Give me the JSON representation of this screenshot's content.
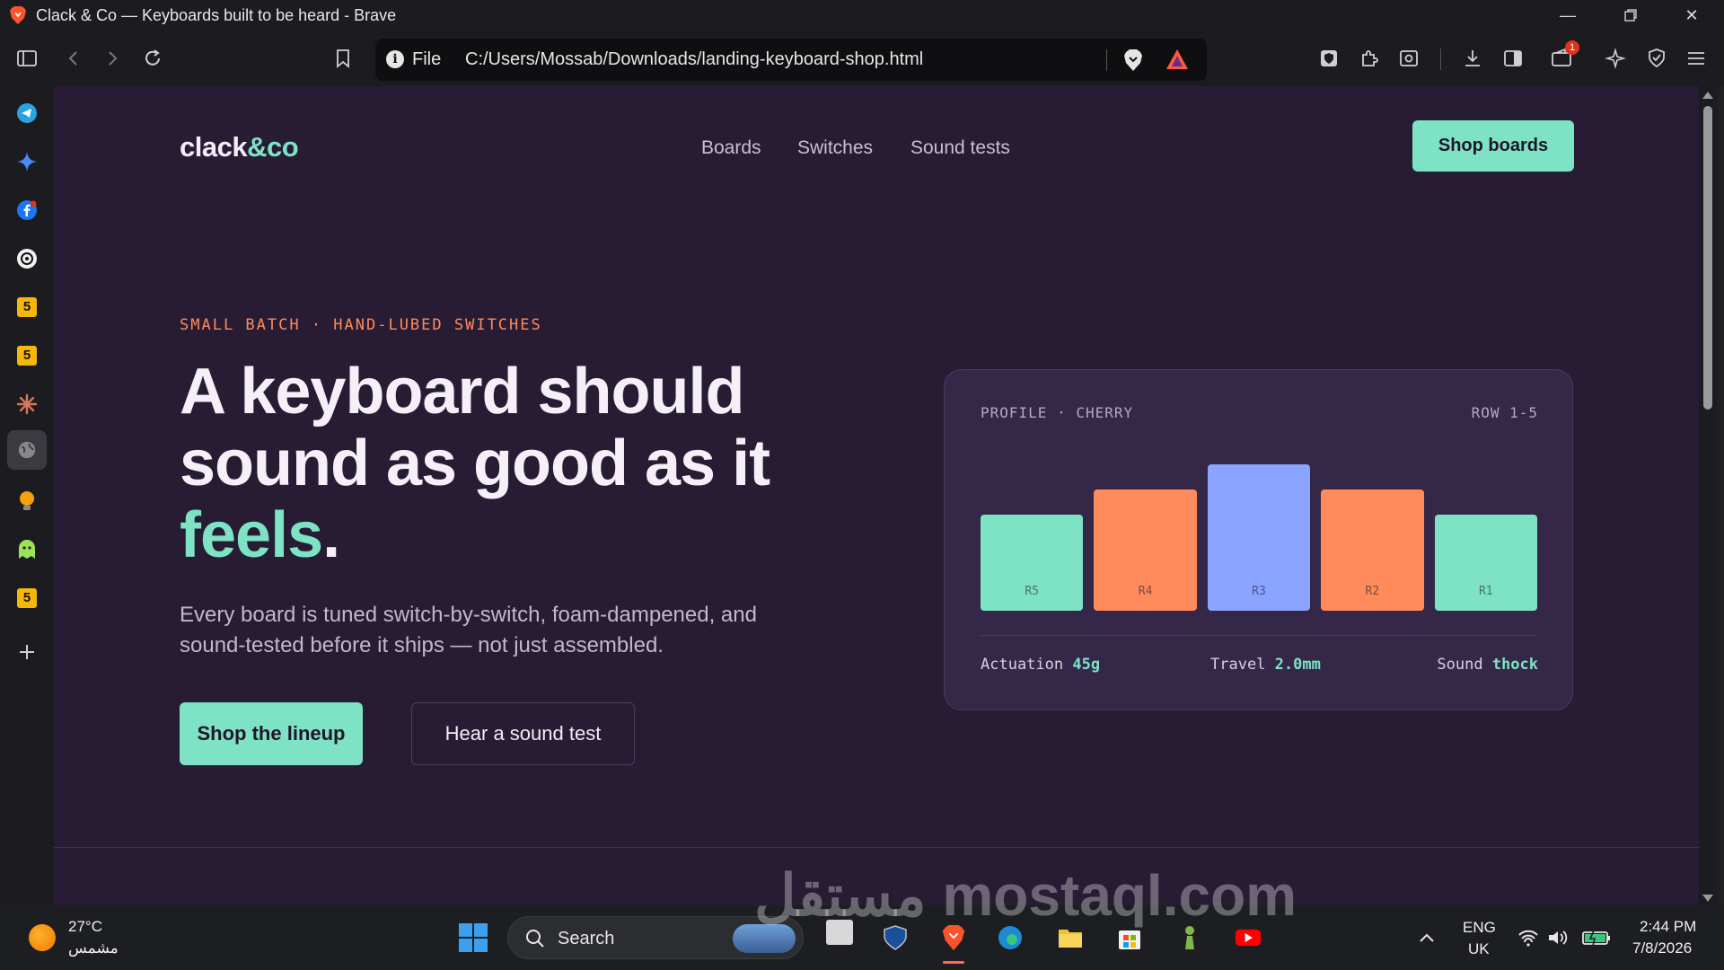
{
  "window": {
    "title": "Clack & Co — Keyboards built to be heard - Brave"
  },
  "browser": {
    "url_scheme": "File",
    "url": "C:/Users/Mossab/Downloads/landing-keyboard-shop.html",
    "notification_count": "1"
  },
  "site": {
    "logo_main": "clack",
    "logo_amp": "&co",
    "nav": [
      "Boards",
      "Switches",
      "Sound tests"
    ],
    "cta_top": "Shop boards",
    "eyebrow": "SMALL BATCH · HAND-LUBED SWITCHES",
    "headline_line1": "A keyboard should",
    "headline_line2": "sound as good as it",
    "headline_accent": "feels",
    "headline_period": ".",
    "subtext": "Every board is tuned switch-by-switch, foam-dampened, and sound-tested before it ships — not just assembled.",
    "btn_primary": "Shop the lineup",
    "btn_secondary": "Hear a sound test",
    "colors": {
      "background": "#271c34",
      "accent_mint": "#7de3c4",
      "accent_orange": "#ff8a5b",
      "accent_blue": "#8aa4ff"
    }
  },
  "card": {
    "profile_label": "PROFILE · CHERRY",
    "rows_label": "ROW 1-5",
    "keys": [
      {
        "label": "R5",
        "height_fraction": 0.54,
        "color": "#7de3c4"
      },
      {
        "label": "R4",
        "height_fraction": 0.68,
        "color": "#ff8a5b"
      },
      {
        "label": "R3",
        "height_fraction": 0.82,
        "color": "#8aa4ff"
      },
      {
        "label": "R2",
        "height_fraction": 0.68,
        "color": "#ff8a5b"
      },
      {
        "label": "R1",
        "height_fraction": 0.54,
        "color": "#7de3c4"
      }
    ],
    "specs": [
      {
        "name": "Actuation",
        "value": "45g"
      },
      {
        "name": "Travel",
        "value": "2.0mm"
      },
      {
        "name": "Sound",
        "value": "thock"
      }
    ]
  },
  "taskbar": {
    "weather_temp": "27°C",
    "weather_desc": "مشمس",
    "search_label": "Search",
    "lang_top": "ENG",
    "lang_bottom": "UK",
    "time": "2:44 PM",
    "date": "7/8/2026"
  },
  "watermark": "مستقل mostaql.com"
}
